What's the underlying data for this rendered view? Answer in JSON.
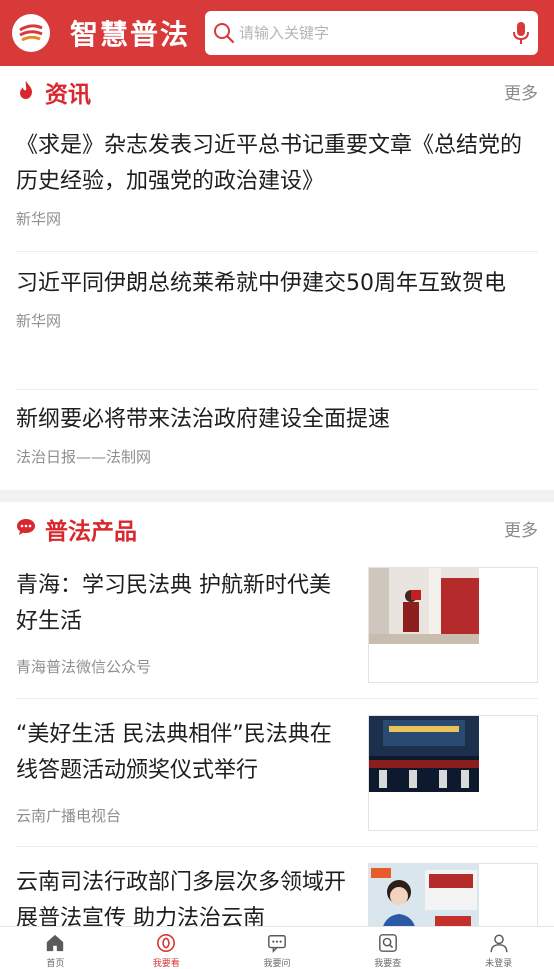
{
  "header": {
    "app_title": "智慧普法",
    "search_placeholder": "请输入关键字"
  },
  "news_section": {
    "title": "资讯",
    "more": "更多",
    "items": [
      {
        "title": "《求是》杂志发表习近平总书记重要文章《总结党的历史经验，加强党的政治建设》",
        "source": "新华网"
      },
      {
        "title": "习近平同伊朗总统莱希就中伊建交50周年互致贺电",
        "source": "新华网"
      },
      {
        "title": "新纲要必将带来法治政府建设全面提速",
        "source": "法治日报——法制网"
      }
    ]
  },
  "product_section": {
    "title": "普法产品",
    "more": "更多",
    "items": [
      {
        "title": "青海：学习民法典 护航新时代美好生活",
        "source": "青海普法微信公众号"
      },
      {
        "title": "“美好生活 民法典相伴”民法典在线答题活动颁奖仪式举行",
        "source": "云南广播电视台"
      },
      {
        "title": "云南司法行政部门多层次多领域开展普法宣传 助力法治云南",
        "source": ""
      }
    ]
  },
  "tabbar": {
    "items": [
      {
        "label": "首页"
      },
      {
        "label": "我要看"
      },
      {
        "label": "我要问"
      },
      {
        "label": "我要查"
      },
      {
        "label": "未登录"
      }
    ]
  },
  "colors": {
    "brand": "#d83a3a",
    "section_title": "#d8282e"
  }
}
